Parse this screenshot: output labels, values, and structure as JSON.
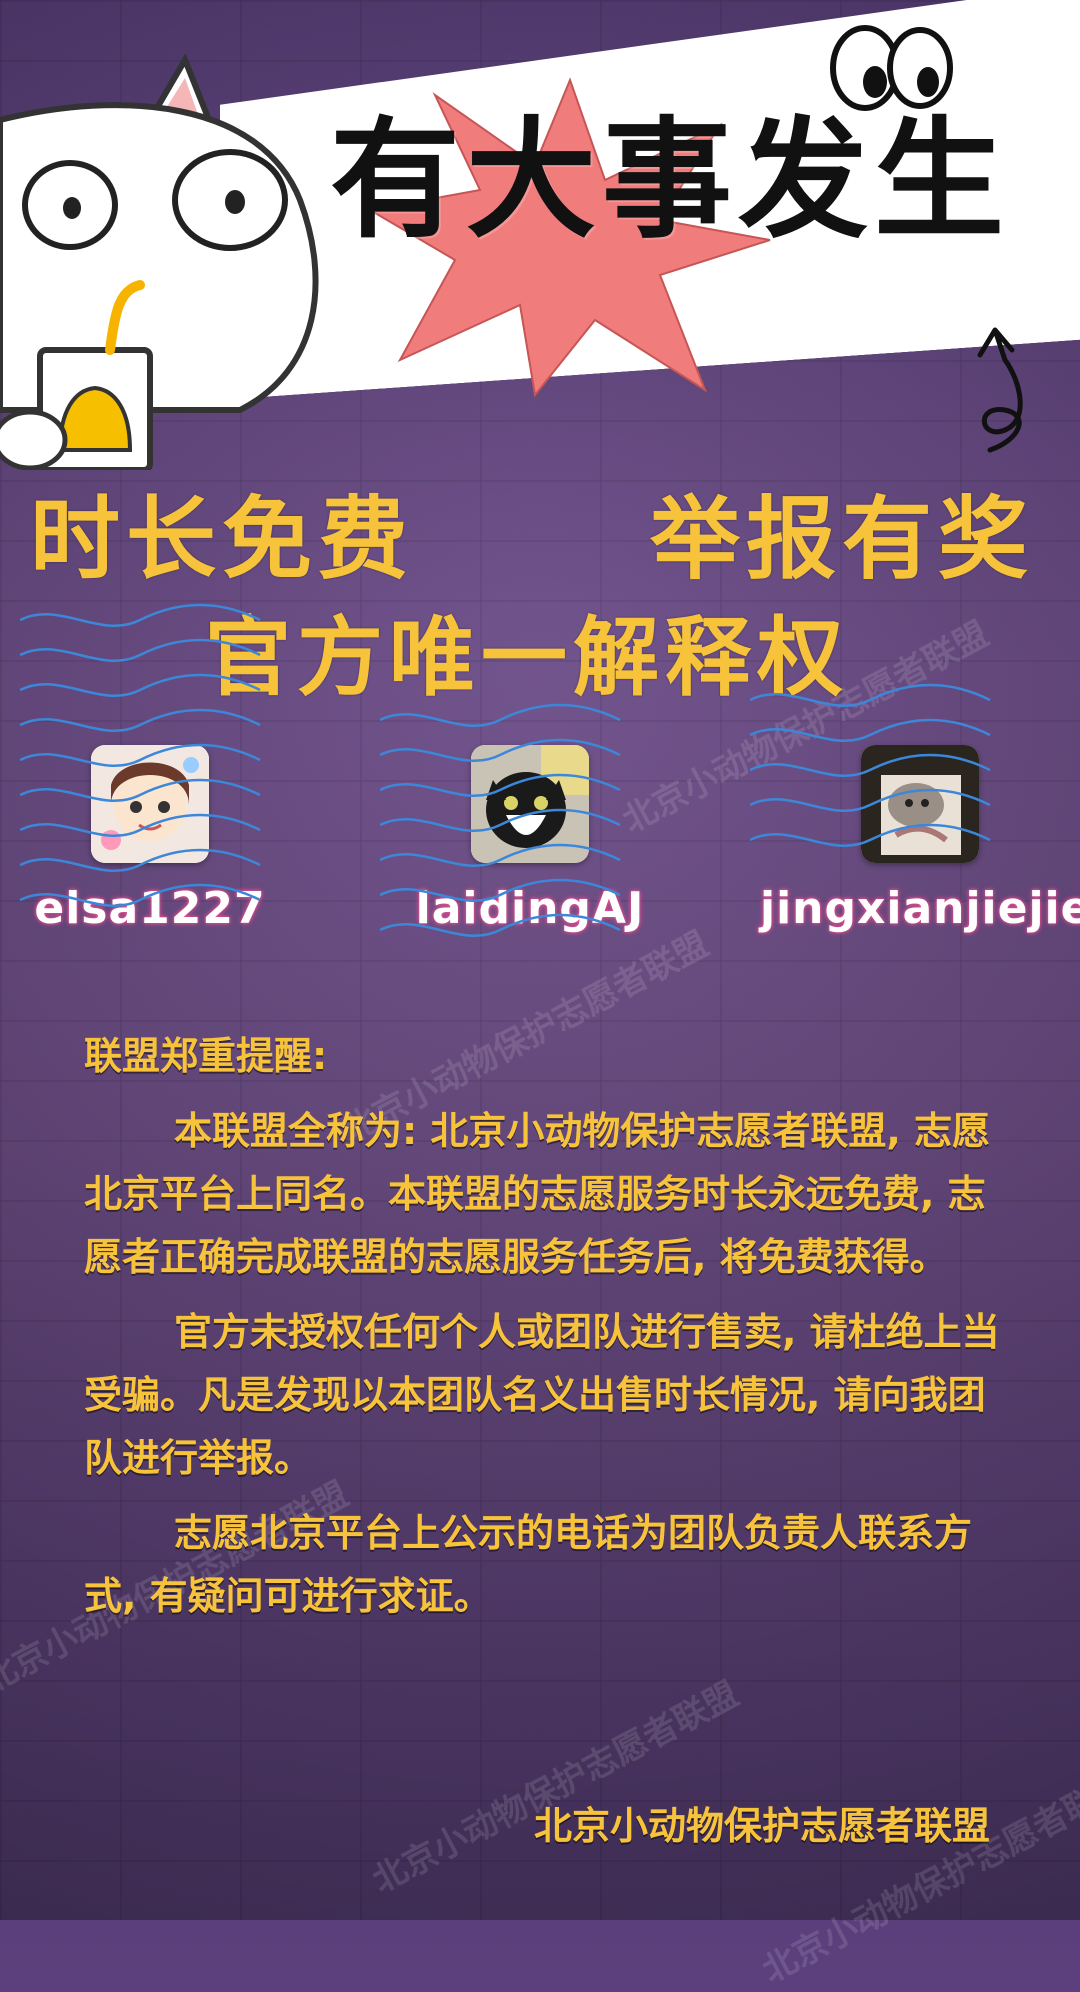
{
  "banner": {
    "headline": "有大事发生"
  },
  "slogans": {
    "left": "时长免费",
    "right": "举报有奖",
    "center": "官方唯一解释权"
  },
  "profiles": [
    {
      "username": "elsa1227",
      "avatar_icon": "anime-girl-avatar"
    },
    {
      "username": "laidingAJ",
      "avatar_icon": "black-white-cat-avatar"
    },
    {
      "username": "jingxianjiejie",
      "avatar_icon": "cat-photo-avatar"
    }
  ],
  "notice": {
    "heading": "联盟郑重提醒:",
    "paragraphs": [
      "本联盟全称为: 北京小动物保护志愿者联盟, 志愿北京平台上同名。本联盟的志愿服务时长永远免费, 志愿者正确完成联盟的志愿服务任务后, 将免费获得。",
      "官方未授权任何个人或团队进行售卖, 请杜绝上当受骗。凡是发现以本团队名义出售时长情况, 请向我团队进行举报。",
      "志愿北京平台上公示的电话为团队负责人联系方式, 有疑问可进行求证。"
    ],
    "signature": "北京小动物保护志愿者联盟"
  },
  "watermark": {
    "text": "北京小动物保护志愿者联盟"
  },
  "colors": {
    "accent_yellow": "#f6c33b",
    "background_purple": "#6a4a86",
    "burst_pink": "#f07c7c"
  }
}
